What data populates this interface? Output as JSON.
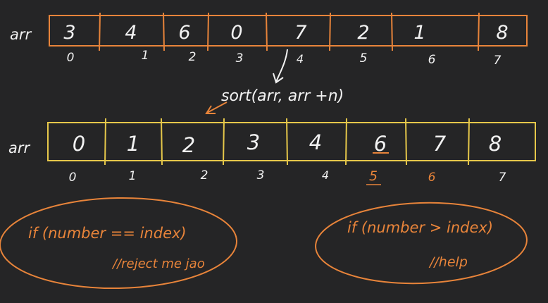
{
  "colors": {
    "background": "#252526",
    "array_box": "#e8843a",
    "white_ink": "#f2f2f2",
    "orange_ink": "#e8843a",
    "sorted_box": "#e6c84a"
  },
  "top_array": {
    "label": "arr",
    "cells": [
      "3",
      "4",
      "6",
      "0",
      "7",
      "2",
      "1",
      "8"
    ],
    "indices": [
      "0",
      "1",
      "2",
      "3",
      "4",
      "5",
      "6",
      "7"
    ]
  },
  "sort_call": "sort(arr, arr +n)",
  "bottom_array": {
    "label": "arr",
    "cells": [
      "0",
      "1",
      "2",
      "3",
      "4",
      "6",
      "7",
      "8"
    ],
    "indices": [
      "0",
      "1",
      "2",
      "3",
      "4",
      "5",
      "6",
      "7"
    ]
  },
  "note_left": {
    "line1": "if (number == index)",
    "line2": "//reject me jao"
  },
  "note_right": {
    "line1": "if (number > index)",
    "line2": "//help"
  }
}
